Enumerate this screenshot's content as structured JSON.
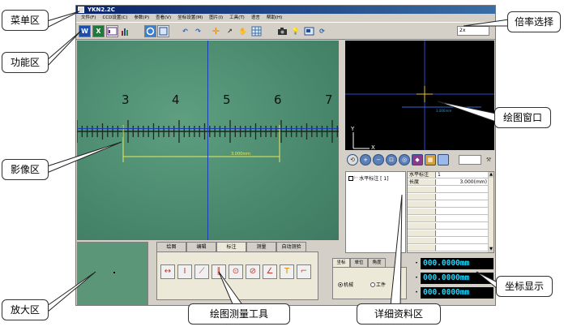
{
  "window": {
    "title": "YKN2.2C"
  },
  "menu": [
    "文件(F)",
    "CCD设置(C)",
    "参数(P)",
    "查看(V)",
    "坐标设置(M)",
    "图片(I)",
    "工具(T)",
    "语言",
    "帮助(H)"
  ],
  "toolbar": {
    "buttons": [
      "W",
      "X",
      "",
      "",
      "",
      "",
      "",
      "",
      "",
      "",
      "",
      "",
      "",
      "",
      "",
      "",
      ""
    ],
    "zoom_value": "2x"
  },
  "image": {
    "ruler_labels": [
      "3",
      "4",
      "5",
      "6",
      "7"
    ],
    "measure_text": "3.000mm"
  },
  "drawing_window": {
    "measure_text": "3.000mm",
    "axis_y": "Y",
    "axis_x": "X"
  },
  "tool_tabs": [
    "绘图",
    "编辑",
    "标注",
    "测量",
    "自动测验"
  ],
  "measure_tools": [
    "↔",
    "I",
    "⟋",
    "∥",
    "⊙",
    "⊘",
    "∠",
    "T",
    "⌐"
  ],
  "detail": {
    "tree_item": "水平标注 [ 1]",
    "table": [
      {
        "key": "水平标注",
        "value": "1"
      },
      {
        "key": "长度",
        "value": "3.000(mm)"
      },
      {
        "key": "",
        "value": ""
      },
      {
        "key": "",
        "value": ""
      },
      {
        "key": "",
        "value": ""
      },
      {
        "key": "",
        "value": ""
      },
      {
        "key": "",
        "value": ""
      },
      {
        "key": "",
        "value": ""
      },
      {
        "key": "",
        "value": ""
      },
      {
        "key": "",
        "value": ""
      },
      {
        "key": "",
        "value": ""
      }
    ]
  },
  "coord_tabs": [
    "坐标",
    "单位",
    "角度"
  ],
  "coord_mode": {
    "option1": "机械",
    "option2": "工件",
    "selected": "机械"
  },
  "coordinates": {
    "x": "000.0000mm",
    "y": "000.0000mm",
    "z": "000.0000mm"
  },
  "callouts": {
    "menu": "菜单区",
    "function": "功能区",
    "image": "影像区",
    "magnify": "放大区",
    "zoom_select": "倍率选择",
    "draw_window": "绘图窗口",
    "coord_display": "坐标显示",
    "tools": "绘图测量工具",
    "detail": "详细资料区"
  },
  "colors": {
    "accent": "#1a3fb0",
    "coord_text": "#1fd8ff",
    "measure_line": "#e8e85a"
  }
}
